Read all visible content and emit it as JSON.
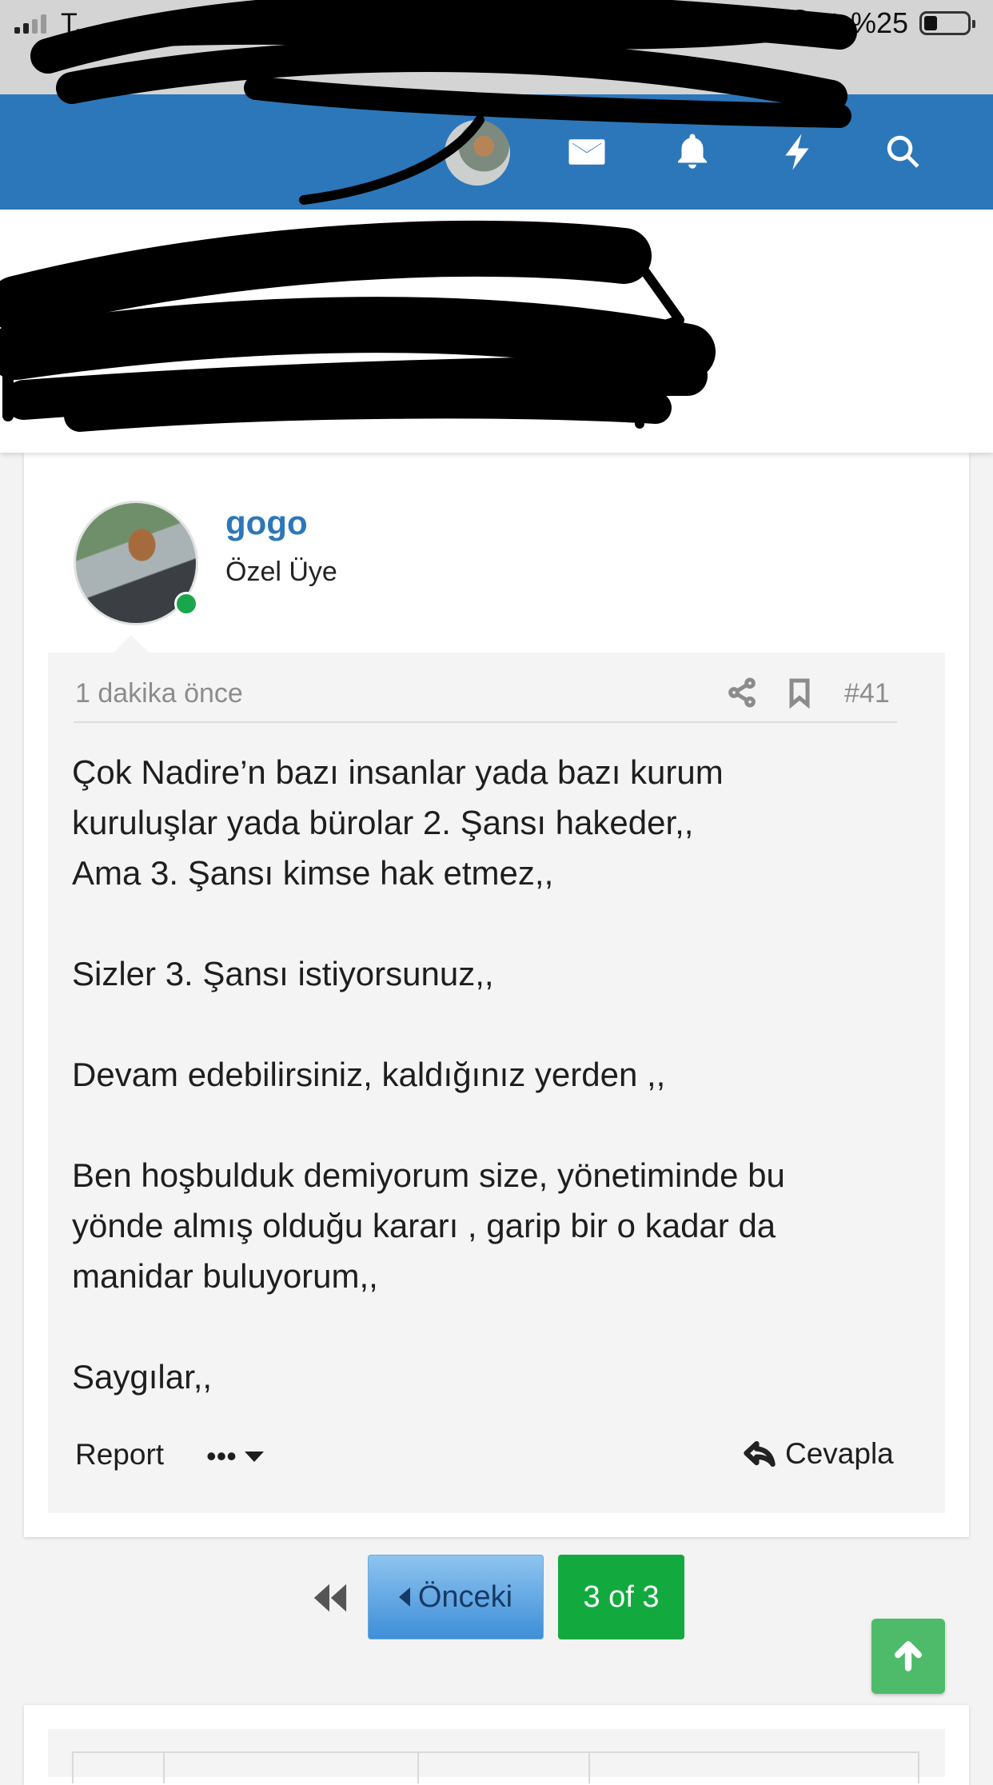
{
  "status_bar": {
    "carrier": "T...",
    "battery_percent": "%25",
    "battery_level": 0.25
  },
  "header": {
    "icons": [
      "avatar",
      "envelope-icon",
      "bell-icon",
      "bolt-icon",
      "search-icon"
    ]
  },
  "post": {
    "author": "gogo",
    "author_title": "Özel Üye",
    "online": true,
    "time": "1 dakika önce",
    "post_number": "#41",
    "paragraphs": [
      "Çok Nadire’n bazı insanlar yada bazı kurum",
      "kuruluşlar yada bürolar 2. Şansı hakeder,,",
      "Ama 3. Şansı kimse hak etmez,,",
      "",
      "Sizler 3. Şansı istiyorsunuz,,",
      "",
      "Devam edebilirsiniz, kaldığınız yerden ,,",
      "",
      "Ben hoşbulduk demiyorum size, yönetiminde bu",
      "yönde almış olduğu kararı , garip bir o kadar da",
      "manidar buluyorum,,",
      "",
      "Saygılar,,"
    ],
    "report_label": "Report",
    "more_label": "•••",
    "reply_label": "Cevapla"
  },
  "pagination": {
    "prev_label": "Önceki",
    "page_indicator": "3 of 3"
  },
  "colors": {
    "header_blue": "#2c77b9",
    "username_blue": "#2c77b9",
    "online_green": "#1aa64a",
    "page_green": "#12aa3e",
    "scroll_top_green": "#4dbb6a"
  }
}
